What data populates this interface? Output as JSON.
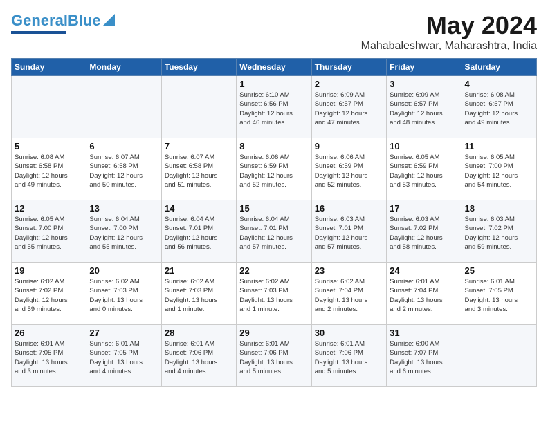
{
  "logo": {
    "line1": "General",
    "line2": "Blue"
  },
  "title": "May 2024",
  "subtitle": "Mahabaleshwar, Maharashtra, India",
  "header_days": [
    "Sunday",
    "Monday",
    "Tuesday",
    "Wednesday",
    "Thursday",
    "Friday",
    "Saturday"
  ],
  "weeks": [
    [
      {
        "day": "",
        "info": ""
      },
      {
        "day": "",
        "info": ""
      },
      {
        "day": "",
        "info": ""
      },
      {
        "day": "1",
        "info": "Sunrise: 6:10 AM\nSunset: 6:56 PM\nDaylight: 12 hours\nand 46 minutes."
      },
      {
        "day": "2",
        "info": "Sunrise: 6:09 AM\nSunset: 6:57 PM\nDaylight: 12 hours\nand 47 minutes."
      },
      {
        "day": "3",
        "info": "Sunrise: 6:09 AM\nSunset: 6:57 PM\nDaylight: 12 hours\nand 48 minutes."
      },
      {
        "day": "4",
        "info": "Sunrise: 6:08 AM\nSunset: 6:57 PM\nDaylight: 12 hours\nand 49 minutes."
      }
    ],
    [
      {
        "day": "5",
        "info": "Sunrise: 6:08 AM\nSunset: 6:58 PM\nDaylight: 12 hours\nand 49 minutes."
      },
      {
        "day": "6",
        "info": "Sunrise: 6:07 AM\nSunset: 6:58 PM\nDaylight: 12 hours\nand 50 minutes."
      },
      {
        "day": "7",
        "info": "Sunrise: 6:07 AM\nSunset: 6:58 PM\nDaylight: 12 hours\nand 51 minutes."
      },
      {
        "day": "8",
        "info": "Sunrise: 6:06 AM\nSunset: 6:59 PM\nDaylight: 12 hours\nand 52 minutes."
      },
      {
        "day": "9",
        "info": "Sunrise: 6:06 AM\nSunset: 6:59 PM\nDaylight: 12 hours\nand 52 minutes."
      },
      {
        "day": "10",
        "info": "Sunrise: 6:05 AM\nSunset: 6:59 PM\nDaylight: 12 hours\nand 53 minutes."
      },
      {
        "day": "11",
        "info": "Sunrise: 6:05 AM\nSunset: 7:00 PM\nDaylight: 12 hours\nand 54 minutes."
      }
    ],
    [
      {
        "day": "12",
        "info": "Sunrise: 6:05 AM\nSunset: 7:00 PM\nDaylight: 12 hours\nand 55 minutes."
      },
      {
        "day": "13",
        "info": "Sunrise: 6:04 AM\nSunset: 7:00 PM\nDaylight: 12 hours\nand 55 minutes."
      },
      {
        "day": "14",
        "info": "Sunrise: 6:04 AM\nSunset: 7:01 PM\nDaylight: 12 hours\nand 56 minutes."
      },
      {
        "day": "15",
        "info": "Sunrise: 6:04 AM\nSunset: 7:01 PM\nDaylight: 12 hours\nand 57 minutes."
      },
      {
        "day": "16",
        "info": "Sunrise: 6:03 AM\nSunset: 7:01 PM\nDaylight: 12 hours\nand 57 minutes."
      },
      {
        "day": "17",
        "info": "Sunrise: 6:03 AM\nSunset: 7:02 PM\nDaylight: 12 hours\nand 58 minutes."
      },
      {
        "day": "18",
        "info": "Sunrise: 6:03 AM\nSunset: 7:02 PM\nDaylight: 12 hours\nand 59 minutes."
      }
    ],
    [
      {
        "day": "19",
        "info": "Sunrise: 6:02 AM\nSunset: 7:02 PM\nDaylight: 12 hours\nand 59 minutes."
      },
      {
        "day": "20",
        "info": "Sunrise: 6:02 AM\nSunset: 7:03 PM\nDaylight: 13 hours\nand 0 minutes."
      },
      {
        "day": "21",
        "info": "Sunrise: 6:02 AM\nSunset: 7:03 PM\nDaylight: 13 hours\nand 1 minute."
      },
      {
        "day": "22",
        "info": "Sunrise: 6:02 AM\nSunset: 7:03 PM\nDaylight: 13 hours\nand 1 minute."
      },
      {
        "day": "23",
        "info": "Sunrise: 6:02 AM\nSunset: 7:04 PM\nDaylight: 13 hours\nand 2 minutes."
      },
      {
        "day": "24",
        "info": "Sunrise: 6:01 AM\nSunset: 7:04 PM\nDaylight: 13 hours\nand 2 minutes."
      },
      {
        "day": "25",
        "info": "Sunrise: 6:01 AM\nSunset: 7:05 PM\nDaylight: 13 hours\nand 3 minutes."
      }
    ],
    [
      {
        "day": "26",
        "info": "Sunrise: 6:01 AM\nSunset: 7:05 PM\nDaylight: 13 hours\nand 3 minutes."
      },
      {
        "day": "27",
        "info": "Sunrise: 6:01 AM\nSunset: 7:05 PM\nDaylight: 13 hours\nand 4 minutes."
      },
      {
        "day": "28",
        "info": "Sunrise: 6:01 AM\nSunset: 7:06 PM\nDaylight: 13 hours\nand 4 minutes."
      },
      {
        "day": "29",
        "info": "Sunrise: 6:01 AM\nSunset: 7:06 PM\nDaylight: 13 hours\nand 5 minutes."
      },
      {
        "day": "30",
        "info": "Sunrise: 6:01 AM\nSunset: 7:06 PM\nDaylight: 13 hours\nand 5 minutes."
      },
      {
        "day": "31",
        "info": "Sunrise: 6:00 AM\nSunset: 7:07 PM\nDaylight: 13 hours\nand 6 minutes."
      },
      {
        "day": "",
        "info": ""
      }
    ]
  ]
}
